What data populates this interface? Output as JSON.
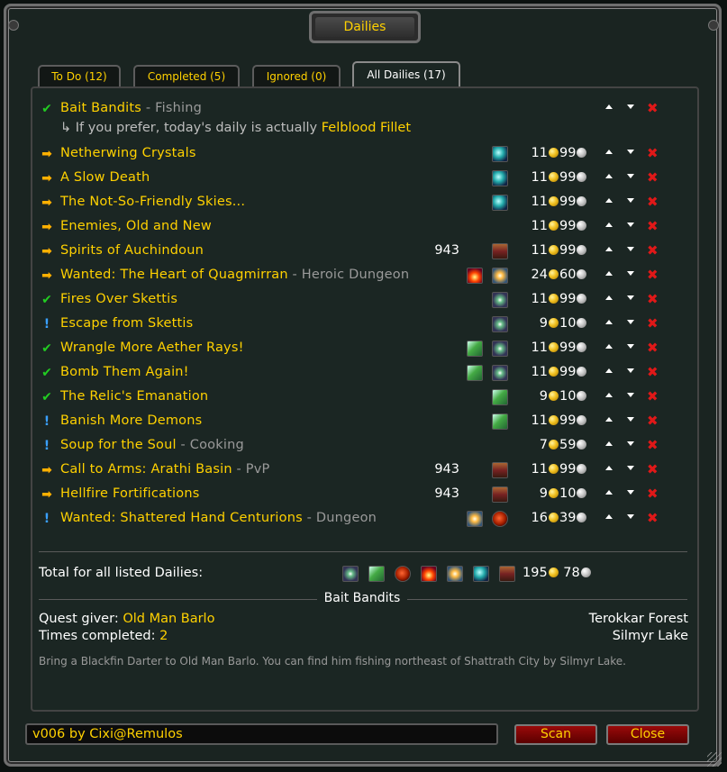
{
  "window": {
    "title": "Dailies"
  },
  "tabs": [
    {
      "label": "To Do (12)",
      "active": false
    },
    {
      "label": "Completed (5)",
      "active": false
    },
    {
      "label": "Ignored (0)",
      "active": false
    },
    {
      "label": "All Dailies (17)",
      "active": true
    }
  ],
  "first": {
    "name": "Bait Bandits",
    "tag": " - Fishing",
    "status": "check",
    "sub_prefix": "↳ If you prefer, today's daily is actually ",
    "sub_quest": "Felblood Fillet"
  },
  "quests": [
    {
      "name": "Netherwing Crystals",
      "tag": "",
      "status": "arrow",
      "icons": [
        "gem"
      ],
      "rep": "",
      "gold": "11",
      "silver": "99"
    },
    {
      "name": "A Slow Death",
      "tag": "",
      "status": "arrow",
      "icons": [
        "gem"
      ],
      "rep": "",
      "gold": "11",
      "silver": "99"
    },
    {
      "name": "The Not-So-Friendly Skies...",
      "tag": "",
      "status": "arrow",
      "icons": [
        "gem"
      ],
      "rep": "",
      "gold": "11",
      "silver": "99"
    },
    {
      "name": "Enemies, Old and New",
      "tag": "",
      "status": "arrow",
      "icons": [],
      "rep": "",
      "gold": "11",
      "silver": "99"
    },
    {
      "name": "Spirits of Auchindoun",
      "tag": "",
      "status": "arrow",
      "icons": [
        "chest"
      ],
      "rep": "943",
      "gold": "11",
      "silver": "99"
    },
    {
      "name": "Wanted: The Heart of Quagmirran",
      "tag": " - Heroic Dungeon",
      "status": "arrow",
      "icons": [
        "fire",
        "star"
      ],
      "rep": "",
      "gold": "24",
      "silver": "60"
    },
    {
      "name": "Fires Over Skettis",
      "tag": "",
      "status": "check",
      "icons": [
        "burst"
      ],
      "rep": "",
      "gold": "11",
      "silver": "99"
    },
    {
      "name": "Escape from Skettis",
      "tag": "",
      "status": "excl",
      "icons": [
        "burst"
      ],
      "rep": "",
      "gold": "9",
      "silver": "10"
    },
    {
      "name": "Wrangle More Aether Rays!",
      "tag": "",
      "status": "check",
      "icons": [
        "feather",
        "burst"
      ],
      "rep": "",
      "gold": "11",
      "silver": "99"
    },
    {
      "name": "Bomb Them Again!",
      "tag": "",
      "status": "check",
      "icons": [
        "feather",
        "burst"
      ],
      "rep": "",
      "gold": "11",
      "silver": "99"
    },
    {
      "name": "The Relic's Emanation",
      "tag": "",
      "status": "check",
      "icons": [
        "feather"
      ],
      "rep": "",
      "gold": "9",
      "silver": "10"
    },
    {
      "name": "Banish More Demons",
      "tag": "",
      "status": "excl",
      "icons": [
        "feather"
      ],
      "rep": "",
      "gold": "11",
      "silver": "99"
    },
    {
      "name": "Soup for the Soul",
      "tag": " - Cooking",
      "status": "excl",
      "icons": [],
      "rep": "",
      "gold": "7",
      "silver": "59"
    },
    {
      "name": "Call to Arms: Arathi Basin",
      "tag": " - PvP",
      "status": "arrow",
      "icons": [
        "chest"
      ],
      "rep": "943",
      "gold": "11",
      "silver": "99"
    },
    {
      "name": "Hellfire Fortifications",
      "tag": "",
      "status": "arrow",
      "icons": [
        "chest"
      ],
      "rep": "943",
      "gold": "9",
      "silver": "10"
    },
    {
      "name": "Wanted: Shattered Hand Centurions",
      "tag": " - Dungeon",
      "status": "excl",
      "icons": [
        "star",
        "orb"
      ],
      "rep": "",
      "gold": "16",
      "silver": "39"
    }
  ],
  "status_glyphs": {
    "check": "✔",
    "arrow": "➡",
    "excl": "!"
  },
  "total": {
    "label": "Total for all listed Dailies:",
    "icons": [
      "burst",
      "feather",
      "orb",
      "fire",
      "star",
      "gem",
      "chest"
    ],
    "gold": "195",
    "silver": "78"
  },
  "details": {
    "title": "Bait Bandits",
    "giver_label": "Quest giver: ",
    "giver": "Old Man Barlo",
    "times_label": "Times completed: ",
    "times": "2",
    "zone": "Terokkar Forest",
    "subzone": "Silmyr Lake",
    "description": "Bring a Blackfin Darter to Old Man Barlo.  You can find him fishing northeast of Shattrath City by Silmyr Lake."
  },
  "footer": {
    "version": "v006 by Cixi@Remulos",
    "scan_label": "Scan",
    "close_label": "Close"
  },
  "colors": {
    "gold_text": "#ffd100",
    "tag_gray": "#9a9a9a",
    "delete_red": "#e01818",
    "check_green": "#22cc22",
    "arrow_orange": "#ffb000",
    "excl_blue": "#3aa0ff"
  }
}
